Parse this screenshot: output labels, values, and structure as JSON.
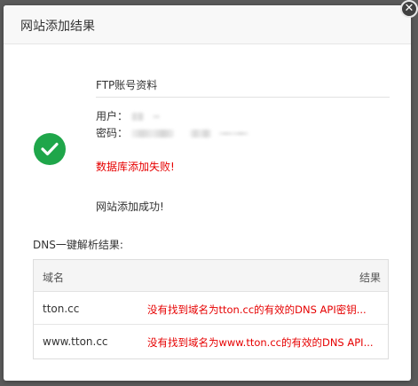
{
  "dialog": {
    "title": "网站添加结果",
    "close_glyph": "✕"
  },
  "ftp": {
    "title": "FTP账号资料",
    "user_label": "用户：",
    "pass_label": "密码："
  },
  "messages": {
    "db_fail": "数据库添加失败!",
    "site_ok": "网站添加成功!"
  },
  "dns": {
    "title": "DNS一键解析结果:",
    "headers": {
      "domain": "域名",
      "result": "结果"
    },
    "rows": [
      {
        "domain": "tton.cc",
        "result": "没有找到域名为tton.cc的有效的DNS API密钥..."
      },
      {
        "domain": "www.tton.cc",
        "result": "没有找到域名为www.tton.cc的有效的DNS API..."
      }
    ]
  },
  "colors": {
    "success_green": "#1fa64a",
    "error_red": "#e60000"
  },
  "icons": {
    "status": "check-circle-icon",
    "close": "close-icon"
  }
}
